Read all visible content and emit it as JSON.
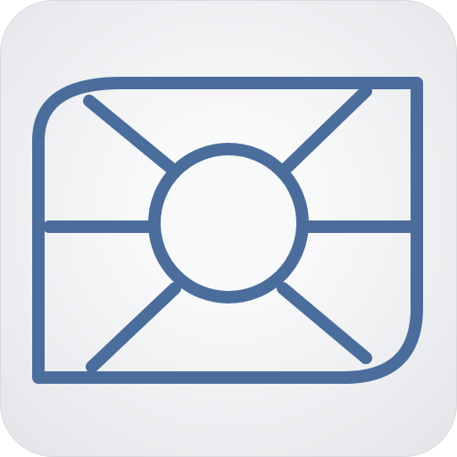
{
  "icon": {
    "name": "sim-card-icon",
    "colors": {
      "stroke": "#4A6D9C",
      "background_center": "#FFFFFF",
      "background_edge": "#E2E4E7"
    }
  }
}
